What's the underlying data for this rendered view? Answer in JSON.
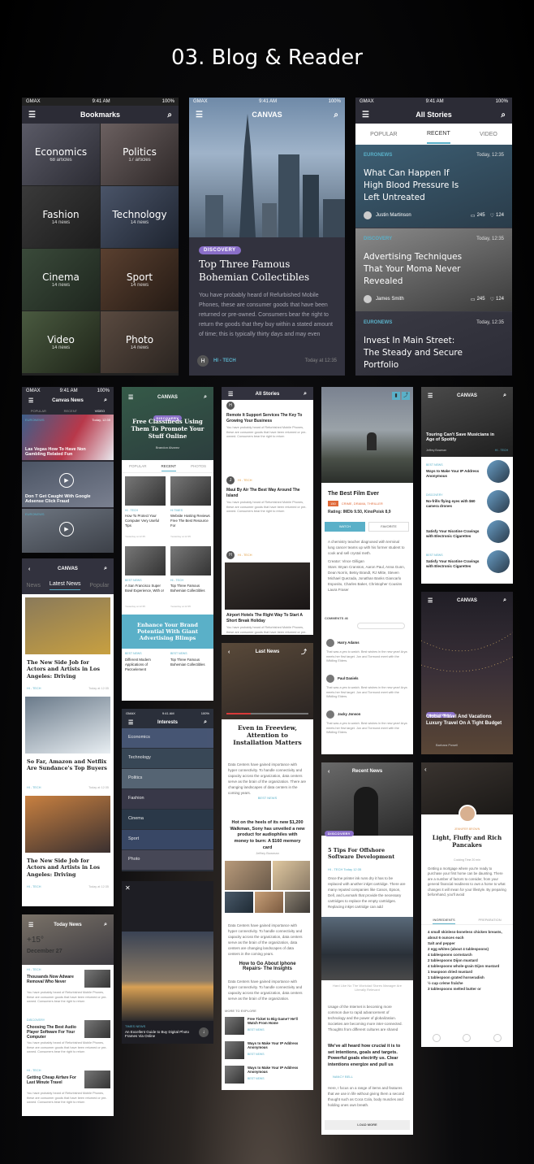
{
  "page_title": "03. Blog & Reader",
  "status": {
    "carrier": "GMAX",
    "time": "9:41 AM",
    "battery": "100%"
  },
  "bookmarks": {
    "title": "Bookmarks",
    "tiles": [
      {
        "name": "Economics",
        "count": "68 articles"
      },
      {
        "name": "Politics",
        "count": "17 articles"
      },
      {
        "name": "Fashion",
        "count": "14 news"
      },
      {
        "name": "Technology",
        "count": "14 news"
      },
      {
        "name": "Cinema",
        "count": "14 news"
      },
      {
        "name": "Sport",
        "count": "14 news"
      },
      {
        "name": "Video",
        "count": "14 news"
      },
      {
        "name": "Photo",
        "count": "14 news"
      }
    ]
  },
  "canvas_article": {
    "brand": "CANVAS",
    "tag": "DISCOVERY",
    "headline": "Top Three Famous Bohemian Collectibles",
    "body": "You have probably heard of Refurbished Mobile Phones, these are consumer goods that have been returned or pre-owned. Consumers bear the right to return the goods that they buy within a stated amount of time; this is typically thirty days and may even",
    "author_initial": "H",
    "category": "HI - TECH",
    "time": "Today at 12:35"
  },
  "all_stories": {
    "title": "All Stories",
    "tabs": [
      "POPULAR",
      "RECENT",
      "VIDEO"
    ],
    "stories": [
      {
        "tag": "EURONEWS",
        "time": "Today, 12:35",
        "title": "What Can Happen If High Blood Pressure Is Left Untreated",
        "author": "Justin Martinson",
        "comments": "245",
        "likes": "124"
      },
      {
        "tag": "DISCOVERY",
        "time": "Today, 12:35",
        "title": "Advertising Techniques That Your Moma Never Revealed",
        "author": "James Smith",
        "comments": "245",
        "likes": "124"
      },
      {
        "tag": "EURONEWS",
        "time": "Today, 12:35",
        "title": "Invest In Main Street: The Steady and Secure Portfolio",
        "author": "",
        "comments": "",
        "likes": ""
      }
    ]
  },
  "canvas_news": {
    "title": "Canvas News",
    "tabs": [
      "POPULAR",
      "RECENT",
      "VIDEO"
    ],
    "items": [
      {
        "tag": "EURONEWS",
        "time": "Today, 12:35",
        "title": "Las Vegas How To Have Non Gambling Related Fun"
      },
      {
        "tag": "",
        "time": "",
        "title": "Don T Get Caught With Google Adsense Click Fraud"
      },
      {
        "tag": "EURONEWS",
        "time": "",
        "title": ""
      }
    ]
  },
  "classifieds": {
    "brand": "CANVAS",
    "tag": "DISCOVERY",
    "headline": "Free Classifieds Using Them To Promote Your Stuff Online",
    "author": "Brandon Alvarez",
    "tabs": [
      "POPULAR",
      "RECENT",
      "PHOTOS"
    ],
    "cards": [
      {
        "tag": "HI - TECH",
        "title": "How To Protect Your Computer Very Useful Tips",
        "time": "Yesterday at 12:35"
      },
      {
        "tag": "HI TIMES",
        "title": "Website Hosting Reviews Free The Best Resource For",
        "time": "Yesterday at 12:35"
      },
      {
        "tag": "BEST NEWS",
        "title": "A San Francisco Super Bowl Experience, With or",
        "time": "Yesterday at 12:35"
      },
      {
        "tag": "HI - TECH",
        "title": "Top Three Famous Bohemian Collectibles",
        "time": "Yesterday at 12:35"
      }
    ],
    "promo": "Enhance Your Brand Potential With Giant Advertising Blimps",
    "cards2": [
      {
        "tag": "BEST NEWS",
        "title": "Different Modern Applications of Piezoelement"
      },
      {
        "tag": "BEST NEWS",
        "title": "Top Three Famous Bohemian Collectibles"
      }
    ]
  },
  "feed": {
    "title": "All Stories",
    "posts": [
      {
        "initial": "H",
        "title": "Remote It Support Services The Key To Growing Your Business",
        "body": "You have probably heard of Refurbished Mobile Phones, these are consumer goods that have been returned or pre-owned. Consumers bear the right to return"
      },
      {
        "initial": "J",
        "tag": "HI - TECH",
        "title": "Maui By Air The Best Way Around The Island",
        "body": "You have probably heard of Refurbished Mobile Phones, these are consumer goods that have been returned or pre-owned. Consumers bear the right to return"
      },
      {
        "initial": "H",
        "tag": "HI - TECH",
        "title": "Airport Hotels The Right Way To Start A Short Break Holiday",
        "body": "You have probably heard of Refurbished Mobile Phones, these are consumer goods that have been returned or pre-owned. Consumers bear the right to return"
      }
    ]
  },
  "film": {
    "title": "The Best Film Ever",
    "badge": "150",
    "genres": "CRIME, DRAMA, THRILLER",
    "rating": "Rating: IMDb 9.50, KinoPoisk 8,9",
    "buttons": [
      "WATCH",
      "FAVORITE"
    ],
    "synopsis": "A chemistry teacher diagnosed with terminal lung cancer teams up with his former student to cook and sell crystal meth.",
    "credits": "Creator: Vince Gilligan\nStars: Bryan Cranston, Aaron Paul, Anna Gunn, Dean Norris, Betsy Brandt, RJ Mitte, Steven Michael Quezada, Jonathan Banks Giancarlo Esposito, Charles Baker, Christopher Cousins Laura Fraser",
    "comments_title": "COMMENTS 46",
    "comments": [
      {
        "name": "Harry Adams",
        "text": "That was a yes to watch. Best wishes in the new year! Arya meets her first target. Jon and Tormund meet with the Wildling Elders."
      },
      {
        "name": "Paul Daniels",
        "text": "That was a yes to watch. Best wishes in the new year! Arya meets her first target. Jon and Tormund meet with the Wildling Elders."
      },
      {
        "name": "Jacky Jonson",
        "text": "That was a yes to watch. Best wishes in the new year! Arya meets her first target. Jon and Tormund meet with the Wildling Elders."
      }
    ]
  },
  "musicians": {
    "brand": "CANVAS",
    "headline": "Touring Can't Save Musicians in Age of Spotify",
    "author": "Jeffrey Bowman",
    "category": "HI - TECH",
    "items": [
      {
        "tag": "BEST NEWS",
        "title": "Ways to Make Your IP Address Anonymous"
      },
      {
        "tag": "DISCOVERY",
        "title": "No-frills flying eyes with $60 camera drones"
      },
      {
        "tag": "",
        "title": "Satisfy Your Nicotine Cravings with Electronic Cigarettes"
      },
      {
        "tag": "BEST NEWS",
        "title": "Satisfy Your Nicotine Cravings with Electronic Cigarettes"
      }
    ]
  },
  "latest_news": {
    "tabs": [
      "News",
      "Latest News",
      "Popular"
    ],
    "items": [
      {
        "title": "The New Side Job for Actors and Artists in Los Angeles: Driving",
        "tag": "HI - TECH",
        "time": "Today at 12:35"
      },
      {
        "title": "So Far, Amazon and Netflix Are Sundance's Top Buyers",
        "tag": "HI - TECH",
        "time": "Today at 12:35"
      },
      {
        "title": "The New Side Job for Actors and Artists in Los Angeles: Driving",
        "tag": "HI - TECH",
        "time": "Today at 12:35"
      }
    ]
  },
  "interests": {
    "title": "Interests",
    "items": [
      "Economics",
      "Technology",
      "Politics",
      "Fashion",
      "Cinema",
      "Sport",
      "Photo"
    ]
  },
  "player": {
    "title": "Last News",
    "headline": "Even in Freeview, Attention to Installation Matters",
    "tag": "BEST NEWS",
    "body": "Data Centers have gained importance with hyper connectivity. To handle connectivity and capacity across the organization, data centers serve as the brain of the organization. There are changing landscapes of data centers in the coming years.",
    "quote": "Hot on the heels of its new $1,200 Walkman, Sony has unveiled a new product for audiophiles with money to burn: A $160 memory card",
    "quote_author": "Jeffrey Bowman",
    "tag2": "BEST NEWS",
    "body2": "Data Centers have gained importance with hyper connectivity. To handle connectivity and capacity across the organization, data centers serve as the brain of the organization, data centers are changing landscapes of data centers in the coming years.",
    "headline2": "How to Go About Iphone Repairs- The Insights",
    "body3": "Data Centers have gained importance with hyper connectivity. To handle connectivity and capacity across the organization, data centers serve as the brain of the organization.",
    "more_title": "MORE TO EXPLORE",
    "more": [
      {
        "title": "Free Ticket to Big Game? He'll Watch From Home",
        "tag": "BEST NEWS"
      },
      {
        "title": "Ways to Make Your IP Address Anonymous",
        "tag": "BEST NEWS"
      },
      {
        "title": "Ways to Make Your IP Address Anonymous",
        "tag": "BEST NEWS"
      }
    ]
  },
  "global_travel": {
    "brand": "CANVAS",
    "tag": "DISCOVERY",
    "headline": "Global Travel And Vacations Luxury Travel On A Tight Budget",
    "author": "Barbara Powell"
  },
  "recent_news": {
    "title": "Recent News",
    "tag": "DISCOVERY",
    "headline": "5 Tips For Offshore Software Development",
    "meta": "HI - TECH   Today 12:35",
    "body": "Once the printer ink runs dry it has to be replaced with another inkjet cartridge. There are many reputed companies like Canon, Epson, Dell, and Lexmark that provide the necessary cartridges to replace the empty cartridges. Replacing inkjet cartridge can add",
    "caption": "Hard Like No The Workdad Stores Manager Are Literally Relevant",
    "body2": "Usage of the Internet is becoming more common due to rapid advancement of technology and the power of globalization. Societies are becoming more inter-connected. Thoughts from different cultures are shared",
    "quote": "We've all heard how crucial it is to set intentions, goals and targets. Powerful goals electrify us. Clear intentions energize and pull us",
    "quote_author": "NANCY BELL",
    "body3": "Here, I focus on a range of items and features that we use in life without giving them a second thought such as Coca Cola, body muscles and holding ones own breath.",
    "load_more": "LOAD MORE"
  },
  "recipe": {
    "author": "JENNIFER BROWN",
    "title": "Light, Fluffy and Rich Pancakes",
    "meta": "Cooking Time  20 min",
    "body": "Getting a mortgage where you're ready to purchase your first home can be daunting. There are a number of factors to consider, from your general financial readiness to own a home to what changes it will mean for your lifestyle. By preparing beforehand, you'll avoid",
    "tabs": [
      "INGREDIENTS",
      "PREPARATION"
    ],
    "ingredients": [
      "4 small skinless-boneless chicken breasts, about 6 ounces each",
      "Salt and pepper",
      "2 egg whites (about 4 tablespoons)",
      "4 tablespoons cornstarch",
      "2 tablespoons Dijon mustard",
      "4 tablespoons whole-grain Dijon mustard",
      "1 teaspoon dried mustard",
      "1 tablespoon grated horseradish",
      "½ cup crème fraîche",
      "3 tablespoons melted butter or"
    ]
  },
  "today_news": {
    "title": "Today News",
    "temp": "+15°",
    "date": "December 27",
    "items": [
      {
        "tag": "HI - TECH",
        "title": "Thousands Now Adware Removal Who Never",
        "body": "You have probably heard of Refurbished Mobile Phones, these are consumer goods that have been returned or pre-owned. Consumers bear the right to return"
      },
      {
        "tag": "DISCOVERY",
        "title": "Choosing The Best Audio Player Software For Your Computer",
        "body": "You have probably heard of Refurbished Mobile Phones, these are consumer goods that have been returned or pre-owned. Consumers bear the right to return"
      },
      {
        "tag": "HI - TECH",
        "title": "Getting Cheap Airfare For Last Minute Travel",
        "body": "You have probably heard of Refurbished Mobile Phones, these are consumer goods that have been returned or pre-owned. Consumers bear the right to return"
      }
    ]
  },
  "photo_view": {
    "tag": "TIMES NEWS",
    "caption": "An Excellent Guide to Buy Digital Photo Frames Via Online"
  },
  "colors": {
    "accent": "#5ab0c8",
    "purple": "#8a6fc9",
    "dark": "#2f2f3a"
  }
}
